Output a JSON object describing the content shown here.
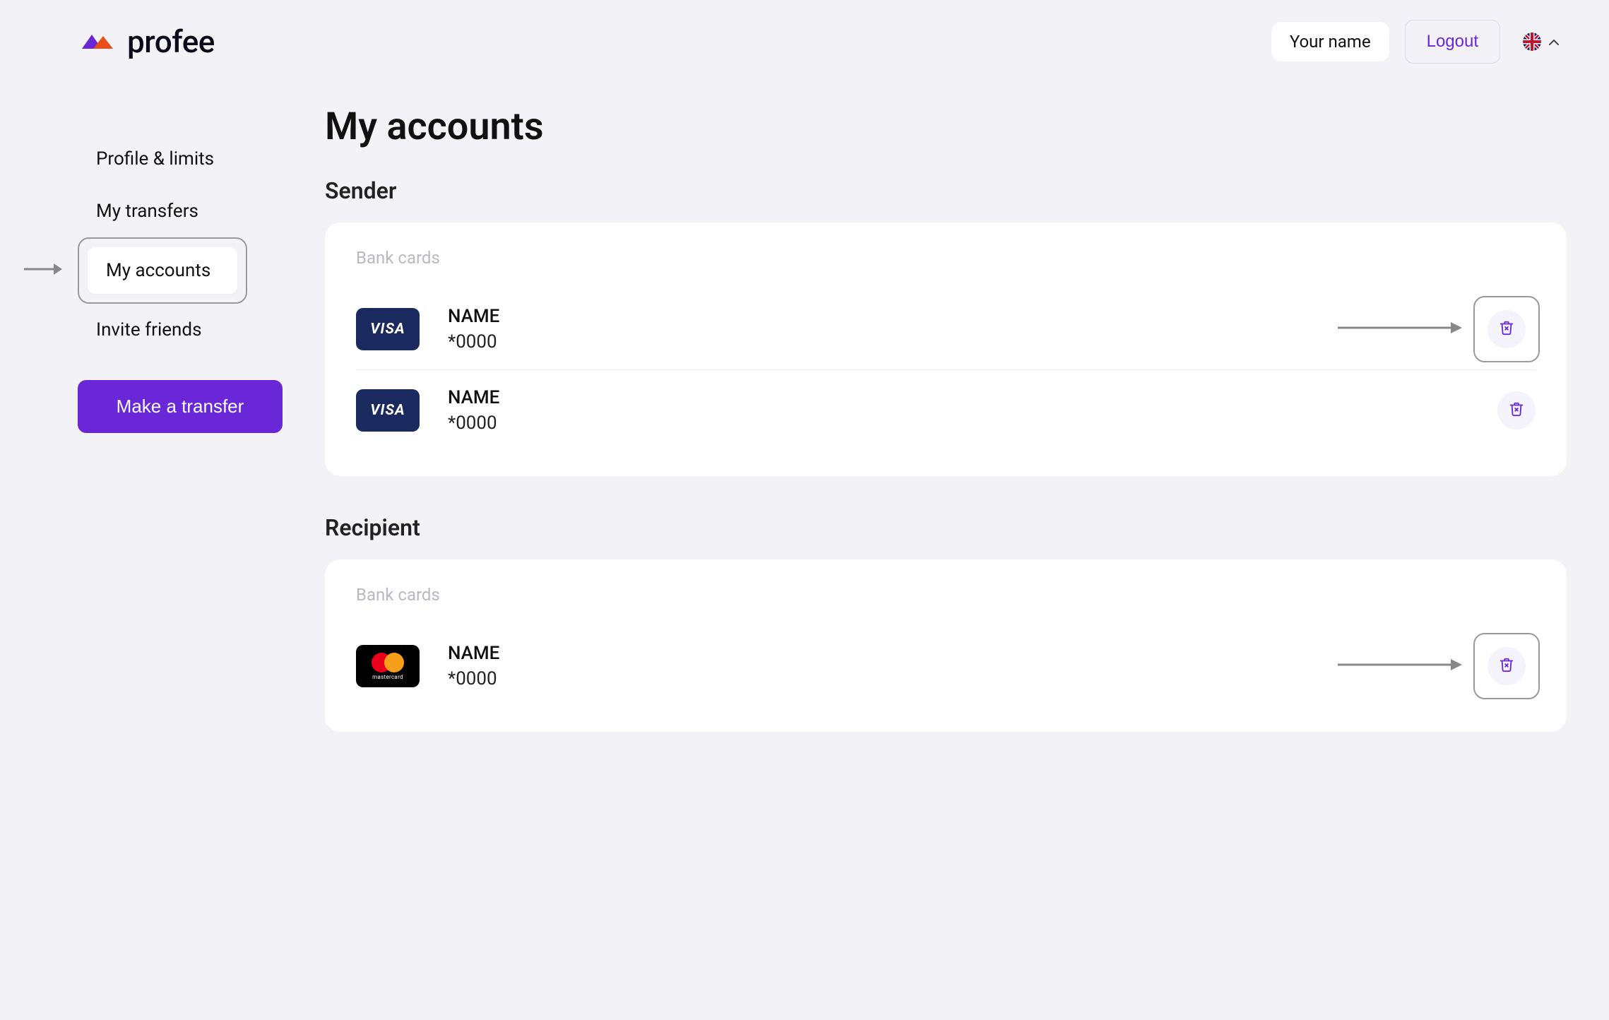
{
  "header": {
    "brand": "profee",
    "user_name": "Your name",
    "logout_label": "Logout"
  },
  "sidebar": {
    "items": [
      {
        "label": "Profile & limits"
      },
      {
        "label": "My transfers"
      },
      {
        "label": "My accounts"
      },
      {
        "label": "Invite friends"
      }
    ],
    "cta_label": "Make a transfer"
  },
  "main": {
    "page_title": "My accounts",
    "sections": [
      {
        "title": "Sender",
        "group_label": "Bank cards",
        "cards": [
          {
            "brand": "visa",
            "brand_label": "VISA",
            "name": "NAME",
            "number": "*0000",
            "highlighted": true
          },
          {
            "brand": "visa",
            "brand_label": "VISA",
            "name": "NAME",
            "number": "*0000",
            "highlighted": false
          }
        ]
      },
      {
        "title": "Recipient",
        "group_label": "Bank cards",
        "cards": [
          {
            "brand": "mastercard",
            "brand_label": "mastercard",
            "name": "NAME",
            "number": "*0000",
            "highlighted": true
          }
        ]
      }
    ]
  }
}
